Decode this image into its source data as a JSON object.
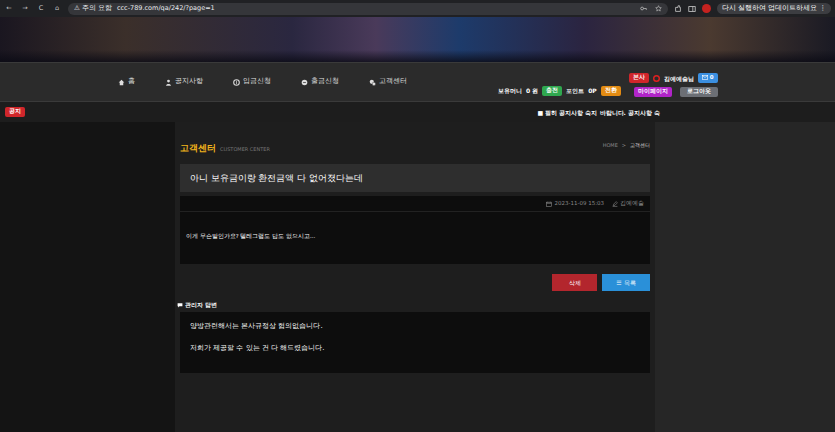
{
  "browser": {
    "back": "←",
    "forward": "→",
    "reload": "C",
    "home": "⌂",
    "security": "⚠ 주의 요함",
    "url": "ccc-789.com/qa/242/?page=1",
    "update": "다시 실행하여 업데이트하세요",
    "menu": "⋮"
  },
  "nav": {
    "items": [
      {
        "label": "홈"
      },
      {
        "label": "공지사항"
      },
      {
        "label": "입금신청"
      },
      {
        "label": "출금신청"
      },
      {
        "label": "고객센터"
      }
    ]
  },
  "account": {
    "badge": "본사",
    "user": "김예예술님",
    "messages": "0",
    "money_label": "보유머니",
    "money": "0 원",
    "charge": "충전",
    "point_label": "포인트",
    "point": "0P",
    "convert": "전환",
    "mypage": "마이페이지",
    "logout": "로그아웃"
  },
  "notice": {
    "badge": "공지",
    "text": "■ 필히 공지사항 숙지 바랍니다. 공지사항 숙"
  },
  "board": {
    "title": "고객센터",
    "subtitle": "CUSTOMER CENTER",
    "crumb_home": "HOME",
    "crumb_sep": ">",
    "crumb_current": "고객센터"
  },
  "post": {
    "title": "아니 보유금이랑 환전금액 다 없어졌다는데",
    "date": "2023-11-09 15:03",
    "author": "김예예술",
    "body": "이게 무슨말인가요? 텔레그램도 답도 없으시고..."
  },
  "buttons": {
    "delete": "삭제",
    "list_icon": "☰",
    "list": "목록"
  },
  "reply": {
    "label": "관리자 답변",
    "lines": [
      "양방관련해서는 본사규정상 협의없습니다.",
      "저희가 제공할 수 있는 건 다 해드렸습니다."
    ]
  }
}
